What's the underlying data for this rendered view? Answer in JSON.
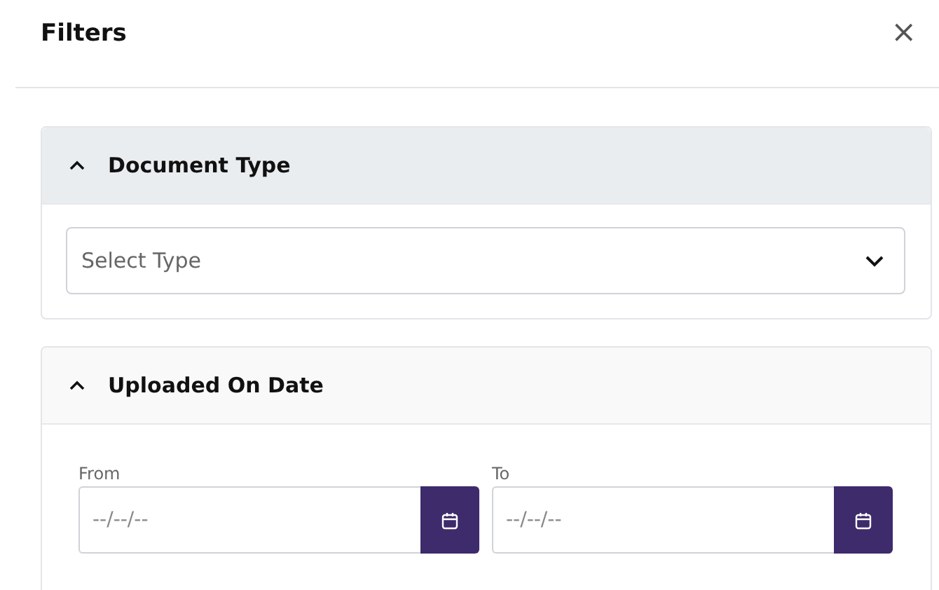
{
  "panel": {
    "title": "Filters",
    "close": "×"
  },
  "sections": [
    {
      "kind": "select",
      "title": "Document Type",
      "expanded": true,
      "hovered": true,
      "placeholder": "Select Type"
    },
    {
      "kind": "date_range",
      "title": "Uploaded On Date",
      "expanded": true,
      "hovered": false,
      "fields": [
        {
          "label": "From",
          "placeholder": "--/--/--"
        },
        {
          "label": "To",
          "placeholder": "--/--/--"
        }
      ]
    }
  ]
}
